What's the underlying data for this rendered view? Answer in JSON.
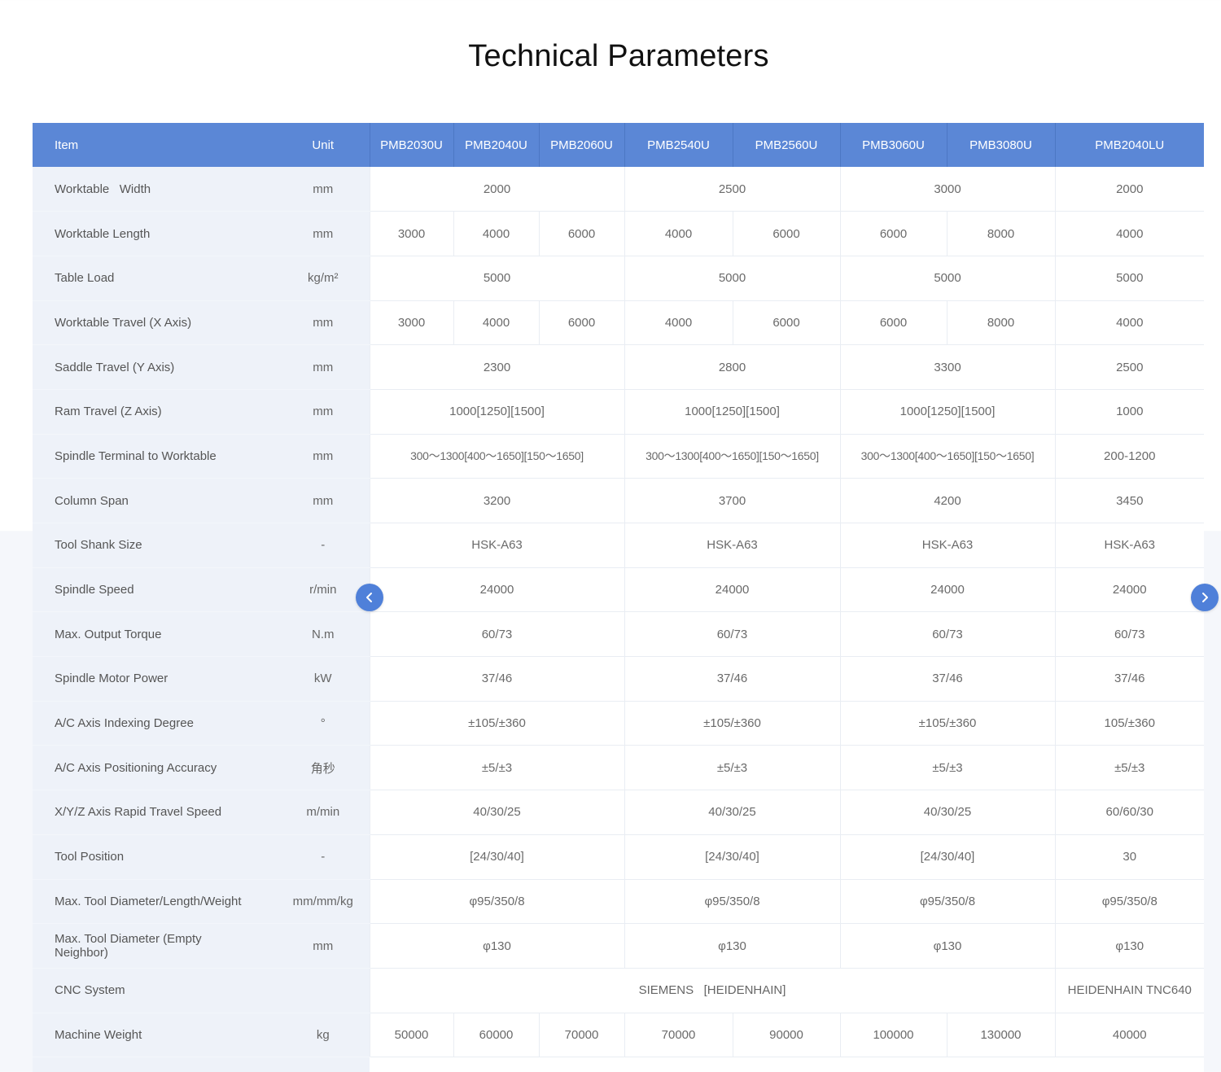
{
  "title": "Technical Parameters",
  "header": {
    "item": "Item",
    "unit": "Unit",
    "models": [
      "PMB2030U",
      "PMB2040U",
      "PMB2060U",
      "PMB2540U",
      "PMB2560U",
      "PMB3060U",
      "PMB3080U",
      "PMB2040LU"
    ]
  },
  "rows": [
    {
      "item": "Worktable   Width",
      "unit": "mm",
      "values": [
        "2000",
        "2500",
        "3000",
        "2000"
      ]
    },
    {
      "item": "Worktable Length",
      "unit": "mm",
      "values": [
        "3000",
        "4000",
        "6000",
        "4000",
        "6000",
        "6000",
        "8000",
        "4000"
      ]
    },
    {
      "item": "Table Load",
      "unit": "kg/m²",
      "values": [
        "5000",
        "5000",
        "5000",
        "5000"
      ]
    },
    {
      "item": "Worktable Travel (X Axis)",
      "unit": "mm",
      "values": [
        "3000",
        "4000",
        "6000",
        "4000",
        "6000",
        "6000",
        "8000",
        "4000"
      ]
    },
    {
      "item": "Saddle Travel (Y Axis)",
      "unit": "mm",
      "values": [
        "2300",
        "2800",
        "3300",
        "2500"
      ]
    },
    {
      "item": "Ram Travel (Z Axis)",
      "unit": "mm",
      "values": [
        "1000[1250][1500]",
        "1000[1250][1500]",
        "1000[1250][1500]",
        "1000"
      ]
    },
    {
      "item": "Spindle Terminal to Worktable",
      "unit": "mm",
      "values": [
        "300～1300[400～1650][150～1650]",
        "300～1300[400～1650][150～1650]",
        "300～1300[400～1650][150～1650]",
        "200-1200"
      ]
    },
    {
      "item": "Column Span",
      "unit": "mm",
      "values": [
        "3200",
        "3700",
        "4200",
        "3450"
      ]
    },
    {
      "item": "Tool Shank Size",
      "unit": "-",
      "values": [
        "HSK-A63",
        "HSK-A63",
        "HSK-A63",
        "HSK-A63"
      ]
    },
    {
      "item": "Spindle Speed",
      "unit": "r/min",
      "values": [
        "24000",
        "24000",
        "24000",
        "24000"
      ]
    },
    {
      "item": "Max. Output Torque",
      "unit": "N.m",
      "values": [
        "60/73",
        "60/73",
        "60/73",
        "60/73"
      ]
    },
    {
      "item": "Spindle Motor Power",
      "unit": "kW",
      "values": [
        "37/46",
        "37/46",
        "37/46",
        "37/46"
      ]
    },
    {
      "item": "A/C Axis Indexing Degree",
      "unit": "°",
      "values": [
        "±105/±360",
        "±105/±360",
        "±105/±360",
        "105/±360"
      ]
    },
    {
      "item": "A/C Axis Positioning Accuracy",
      "unit": "角秒",
      "values": [
        "±5/±3",
        "±5/±3",
        "±5/±3",
        "±5/±3"
      ]
    },
    {
      "item": "X/Y/Z Axis Rapid Travel Speed",
      "unit": "m/min",
      "values": [
        "40/30/25",
        "40/30/25",
        "40/30/25",
        "60/60/30"
      ]
    },
    {
      "item": "Tool Position",
      "unit": "-",
      "values": [
        "[24/30/40]",
        "[24/30/40]",
        "[24/30/40]",
        "30"
      ]
    },
    {
      "item": "Max. Tool Diameter/Length/Weight",
      "unit": "mm/mm/kg",
      "values": [
        "φ95/350/8",
        "φ95/350/8",
        "φ95/350/8",
        "φ95/350/8"
      ]
    },
    {
      "item": "Max. Tool Diameter (Empty Neighbor)",
      "unit": "mm",
      "values": [
        "φ130",
        "φ130",
        "φ130",
        "φ130"
      ]
    },
    {
      "item": "CNC System",
      "unit": "",
      "values": [
        "SIEMENS   [HEIDENHAIN]",
        "HEIDENHAIN TNC640"
      ]
    },
    {
      "item": "Machine Weight",
      "unit": "kg",
      "values": [
        "50000",
        "60000",
        "70000",
        "70000",
        "90000",
        "100000",
        "130000",
        "40000"
      ]
    }
  ],
  "nav": {
    "prev_icon": "chevron-left-icon",
    "next_icon": "chevron-right-icon"
  },
  "colors": {
    "header_bg": "#5b87d6",
    "nav_button": "#4f80d9",
    "label_bg": "#eef2f9"
  }
}
